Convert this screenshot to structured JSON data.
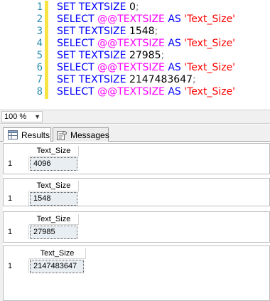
{
  "editor": {
    "lines": [
      {
        "num": "1",
        "parts": [
          [
            "kw",
            "SET TEXTSIZE "
          ],
          [
            "num",
            "0"
          ],
          [
            "punct",
            ";"
          ]
        ]
      },
      {
        "num": "2",
        "parts": [
          [
            "kw",
            "SELECT "
          ],
          [
            "fn",
            "@@TEXTSIZE"
          ],
          [
            "kw",
            " AS "
          ],
          [
            "str",
            "'Text_Size'"
          ]
        ]
      },
      {
        "num": "3",
        "parts": [
          [
            "kw",
            "SET TEXTSIZE "
          ],
          [
            "num",
            "1548"
          ],
          [
            "punct",
            ";"
          ]
        ]
      },
      {
        "num": "4",
        "parts": [
          [
            "kw",
            "SELECT "
          ],
          [
            "fn",
            "@@TEXTSIZE"
          ],
          [
            "kw",
            " AS "
          ],
          [
            "str",
            "'Text_Size'"
          ]
        ]
      },
      {
        "num": "5",
        "parts": [
          [
            "kw",
            "SET TEXTSIZE "
          ],
          [
            "num",
            "27985"
          ],
          [
            "punct",
            ";"
          ]
        ]
      },
      {
        "num": "6",
        "parts": [
          [
            "kw",
            "SELECT "
          ],
          [
            "fn",
            "@@TEXTSIZE"
          ],
          [
            "kw",
            " AS "
          ],
          [
            "str",
            "'Text_Size'"
          ]
        ]
      },
      {
        "num": "7",
        "parts": [
          [
            "kw",
            "SET TEXTSIZE "
          ],
          [
            "num",
            "2147483647"
          ],
          [
            "punct",
            ";"
          ]
        ]
      },
      {
        "num": "8",
        "parts": [
          [
            "kw",
            "SELECT "
          ],
          [
            "fn",
            "@@TEXTSIZE"
          ],
          [
            "kw",
            " AS "
          ],
          [
            "str",
            "'Text_Size'"
          ]
        ]
      }
    ]
  },
  "zoom": {
    "value": "100 %"
  },
  "tabs": [
    {
      "label": "Results",
      "icon": "results-grid-icon",
      "active": true
    },
    {
      "label": "Messages",
      "icon": "messages-icon",
      "active": false
    }
  ],
  "results": [
    {
      "column": "Text_Size",
      "row": "1",
      "value": "4096"
    },
    {
      "column": "Text_Size",
      "row": "1",
      "value": "1548"
    },
    {
      "column": "Text_Size",
      "row": "1",
      "value": "27985"
    },
    {
      "column": "Text_Size",
      "row": "1",
      "value": "2147483647"
    }
  ],
  "colors": {
    "keyword": "#0000ff",
    "system_function": "#ff00ff",
    "string": "#ff0000",
    "line_number": "#2b91af",
    "change_marker": "#f7e443"
  }
}
